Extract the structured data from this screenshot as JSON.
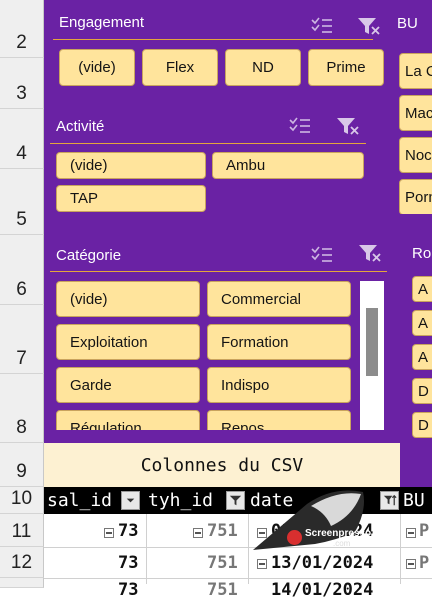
{
  "row_numbers": [
    "2",
    "3",
    "4",
    "5",
    "6",
    "7",
    "8",
    "9",
    "10",
    "11",
    "12",
    ""
  ],
  "slicers": {
    "engagement": {
      "title": "Engagement",
      "items": [
        "(vide)",
        "Flex",
        "ND",
        "Prime"
      ]
    },
    "activite": {
      "title": "Activité",
      "items": [
        "(vide)",
        "Ambu",
        "TAP"
      ]
    },
    "categorie": {
      "title": "Catégorie",
      "items": [
        "(vide)",
        "Commercial",
        "Exploitation",
        "Formation",
        "Garde",
        "Indispo",
        "Régulation",
        "Repos"
      ]
    },
    "bu": {
      "title": "BU",
      "items": [
        "La C",
        "Mac",
        "Noc",
        "Porn"
      ]
    },
    "ro": {
      "title": "Ro",
      "items": [
        "A",
        "A",
        "A",
        "D",
        "D",
        "D"
      ]
    }
  },
  "table": {
    "banner": "Colonnes du CSV",
    "columns": [
      "sal_id",
      "tyh_id",
      "date",
      "BU"
    ],
    "rows": [
      {
        "sal_id": "73",
        "tyh_id": "751",
        "date": "01/01/2024",
        "bu": "P"
      },
      {
        "sal_id": "73",
        "tyh_id": "751",
        "date": "13/01/2024",
        "bu": "P"
      },
      {
        "sal_id": "73",
        "tyh_id": "751",
        "date": "14/01/2024",
        "bu": ""
      }
    ]
  },
  "watermark": {
    "name": "Screenpresso",
    "domain": ".com"
  },
  "colors": {
    "purple": "#6a22a4",
    "chip": "#ffe49c",
    "accent_rule": "#e4a53c",
    "banner": "#fdf1d2"
  }
}
